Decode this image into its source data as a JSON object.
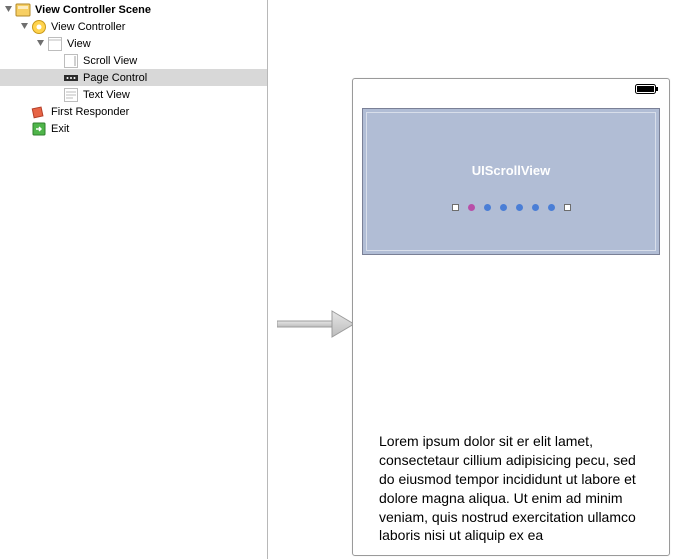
{
  "outline": {
    "scene": "View Controller Scene",
    "view_controller": "View Controller",
    "view": "View",
    "scroll_view": "Scroll View",
    "page_control": "Page Control",
    "text_view": "Text View",
    "first_responder": "First Responder",
    "exit": "Exit"
  },
  "canvas": {
    "scroll_title": "UIScrollView",
    "text_body": "Lorem ipsum dolor sit er elit lamet, consectetaur cillium adipisicing pecu, sed do eiusmod tempor incididunt ut labore et dolore magna aliqua. Ut enim ad minim veniam, quis nostrud exercitation ullamco laboris nisi ut aliquip ex ea"
  }
}
